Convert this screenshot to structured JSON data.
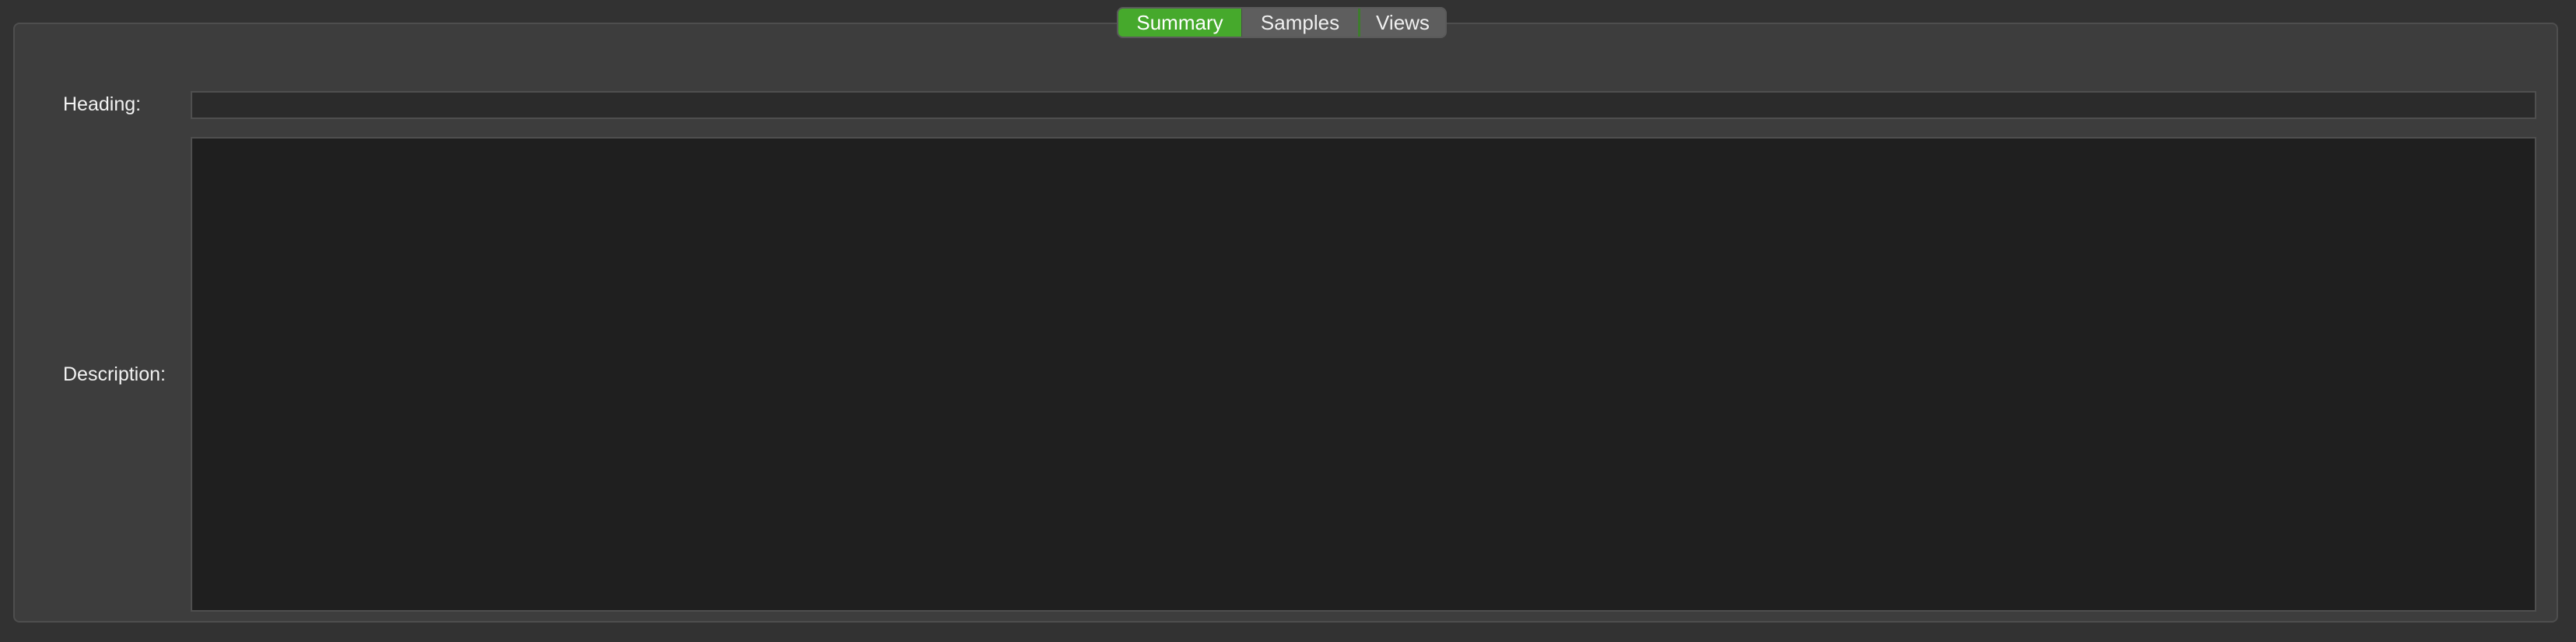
{
  "tabs": {
    "summary": "Summary",
    "samples": "Samples",
    "views": "Views",
    "active": "Summary"
  },
  "form": {
    "heading_label": "Heading:",
    "heading_value": "",
    "description_label": "Description:",
    "description_value": ""
  },
  "colors": {
    "active_tab": "#46a92c",
    "panel_background": "#3d3d3d",
    "window_background": "#323232",
    "field_background": "#1f1f1f"
  }
}
